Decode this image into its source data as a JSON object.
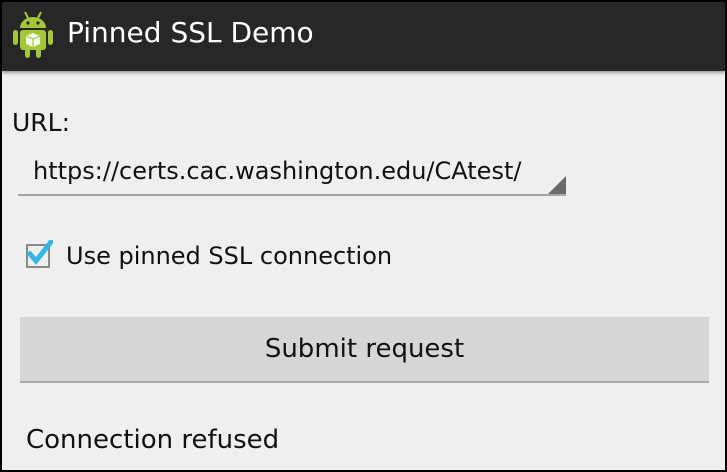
{
  "action_bar": {
    "title": "Pinned SSL Demo",
    "icon": "android-robot-icon",
    "background": "#272727",
    "icon_color": "#a4c639"
  },
  "form": {
    "url_label": "URL:",
    "url_selected": "https://certs.cac.washington.edu/CAtest/",
    "pinned_checkbox": {
      "label": "Use pinned SSL connection",
      "checked": true,
      "accent": "#33b5e5"
    },
    "submit_label": "Submit request"
  },
  "status": {
    "text": "Connection refused"
  }
}
